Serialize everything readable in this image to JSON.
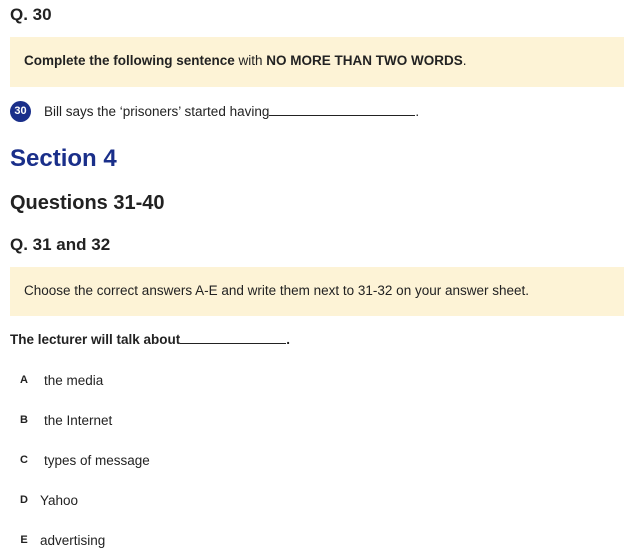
{
  "q30": {
    "heading": "Q. 30",
    "instruction": {
      "part1": "Complete the following sentence",
      "part2": " with ",
      "part3": "NO MORE THAN TWO WORDS",
      "part4": "."
    },
    "badge": "30",
    "text": "Bill says the ‘prisoners’ started having",
    "end": "."
  },
  "section": {
    "title": "Section 4",
    "subtitle": "Questions 31-40"
  },
  "q31_32": {
    "heading": "Q. 31 and 32",
    "instruction": "Choose the correct answers A-E and write them next to 31-32 on your answer sheet.",
    "stem": "The lecturer will talk about",
    "end": ".",
    "options": [
      {
        "letter": "A",
        "text": "the media"
      },
      {
        "letter": "B",
        "text": "the Internet"
      },
      {
        "letter": "C",
        "text": "types of message"
      },
      {
        "letter": "D",
        "text": "Yahoo"
      },
      {
        "letter": "E",
        "text": "advertising"
      }
    ]
  }
}
